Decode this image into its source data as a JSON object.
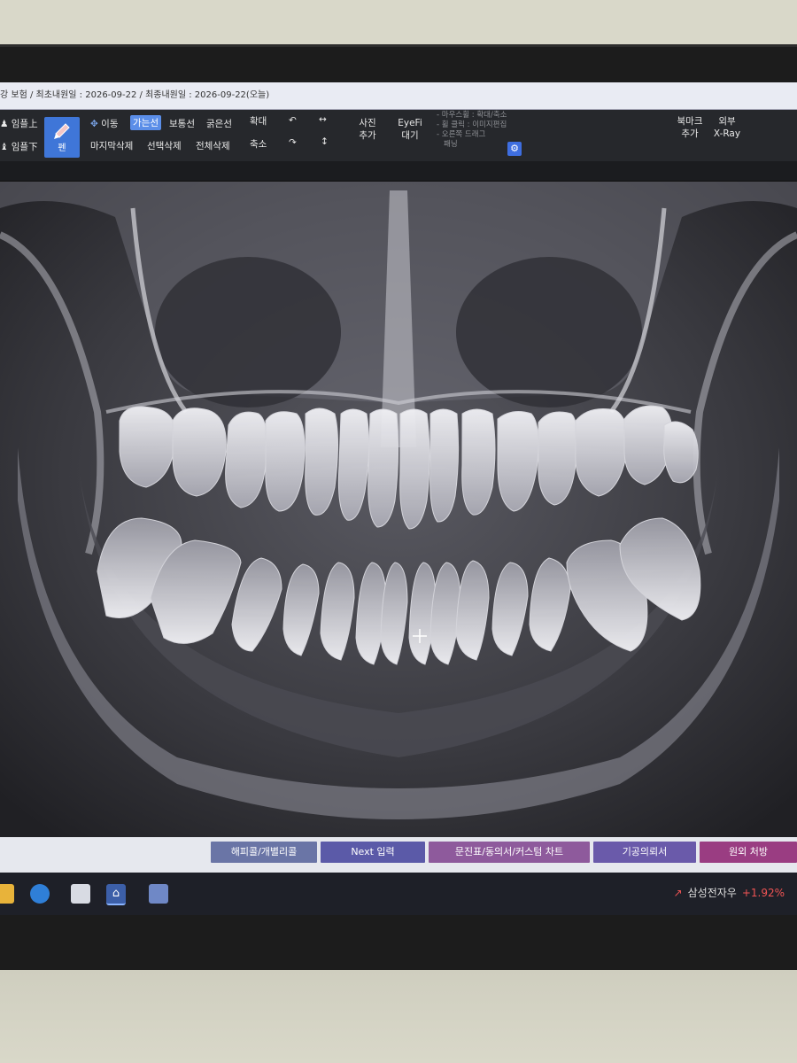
{
  "info_bar": {
    "text": "강 보험 / 최초내원일 : 2026-09-22 / 최종내원일 : 2026-09-22(오늘)"
  },
  "toolbar": {
    "tooth_upper": "임플上",
    "tooth_lower": "임플下",
    "pen": "펜",
    "move": "이동",
    "thin_line": "가는선",
    "normal_line": "보통선",
    "thick_line": "굵은선",
    "zoom_in": "확대",
    "zoom_out": "축소",
    "delete_last": "마지막삭제",
    "delete_selected": "선택삭제",
    "delete_all": "전체삭제",
    "photo_add": [
      "사진",
      "추가"
    ],
    "eyefi_wait": [
      "EyeFi",
      "대기"
    ],
    "hints": [
      "- 마우스휠 : 확대/축소",
      "- 휠 클릭 : 이미지편집",
      "- 오른쪽 드래그",
      "패닝"
    ],
    "bookmark_add": [
      "북마크",
      "추가"
    ],
    "external_xray": [
      "외부",
      "X-Ray"
    ]
  },
  "buttons": [
    {
      "label": "해피콜/개별리콜",
      "color": "#6a75a6"
    },
    {
      "label": "Next 입력",
      "color": "#5b5aa8"
    },
    {
      "label": "문진표/동의서/커스텀 차트",
      "color": "#8e5a9c"
    },
    {
      "label": "기공의뢰서",
      "color": "#6a5aaa"
    },
    {
      "label": "원외 처방",
      "color": "#9a3d82"
    }
  ],
  "taskbar": {
    "stock_name": "삼성전자우",
    "stock_change": "+1.92%"
  }
}
